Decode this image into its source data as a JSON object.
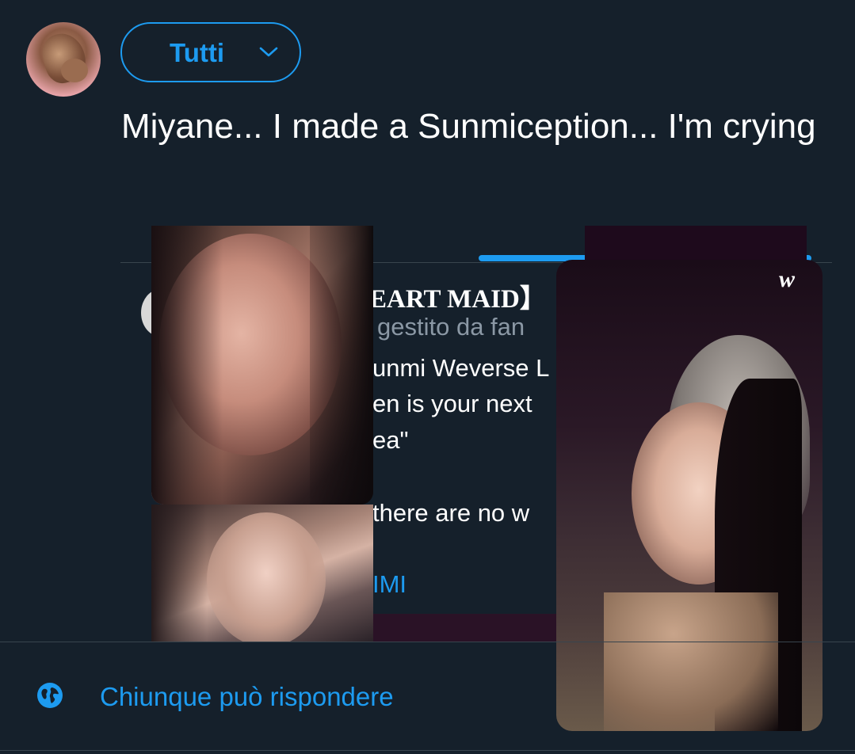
{
  "composer": {
    "audience_label": "Tutti",
    "tweet_text": "Miyane... I made a Sunmiception... I'm crying"
  },
  "quoted_tweet": {
    "title_fragment": "EART MAID】",
    "subtitle_fragment": "gestito da fan",
    "lines": [
      "unmi Weverse L",
      "en is your next",
      "ea\"",
      "there are no w"
    ],
    "link_fragment": "IMI"
  },
  "media": {
    "watermark": "w"
  },
  "footer": {
    "reply_setting": "Chiunque può rispondere"
  },
  "colors": {
    "background": "#15202b",
    "accent": "#1d9bf0",
    "text": "#ffffff",
    "muted": "#8b98a5"
  },
  "icons": {
    "audience_chevron": "chevron-down-icon",
    "reply_setting": "globe-icon"
  }
}
